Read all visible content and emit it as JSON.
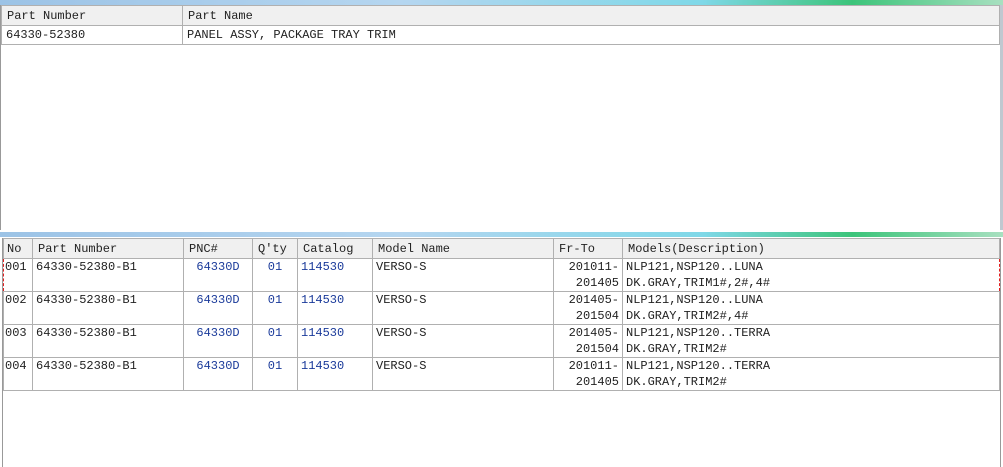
{
  "top_table": {
    "columns": [
      "Part Number",
      "Part Name"
    ],
    "rows": [
      {
        "part_number": "64330-52380",
        "part_name": "PANEL ASSY, PACKAGE TRAY TRIM"
      }
    ]
  },
  "bottom_table": {
    "columns": [
      "No",
      "Part Number",
      "PNC#",
      "Q'ty",
      "Catalog",
      "Model Name",
      "Fr-To",
      "Models(Description)"
    ],
    "rows": [
      {
        "no": "001",
        "part_number": "64330-52380-B1",
        "pnc": "64330D",
        "qty": "01",
        "catalog": "114530",
        "model": "VERSO-S",
        "fr": "201011-",
        "to": "201405",
        "desc1": "NLP121,NSP120..LUNA",
        "desc2": "DK.GRAY,TRIM1#,2#,4#",
        "selected": true
      },
      {
        "no": "002",
        "part_number": "64330-52380-B1",
        "pnc": "64330D",
        "qty": "01",
        "catalog": "114530",
        "model": "VERSO-S",
        "fr": "201405-",
        "to": "201504",
        "desc1": "NLP121,NSP120..LUNA",
        "desc2": "DK.GRAY,TRIM2#,4#"
      },
      {
        "no": "003",
        "part_number": "64330-52380-B1",
        "pnc": "64330D",
        "qty": "01",
        "catalog": "114530",
        "model": "VERSO-S",
        "fr": "201405-",
        "to": "201504",
        "desc1": "NLP121,NSP120..TERRA",
        "desc2": "DK.GRAY,TRIM2#"
      },
      {
        "no": "004",
        "part_number": "64330-52380-B1",
        "pnc": "64330D",
        "qty": "01",
        "catalog": "114530",
        "model": "VERSO-S",
        "fr": "201011-",
        "to": "201405",
        "desc1": "NLP121,NSP120..TERRA",
        "desc2": "DK.GRAY,TRIM2#"
      }
    ]
  },
  "colors": {
    "selection": "#e02020",
    "header_bg": "#f0f0f0",
    "number_text": "#1a3a9a"
  }
}
